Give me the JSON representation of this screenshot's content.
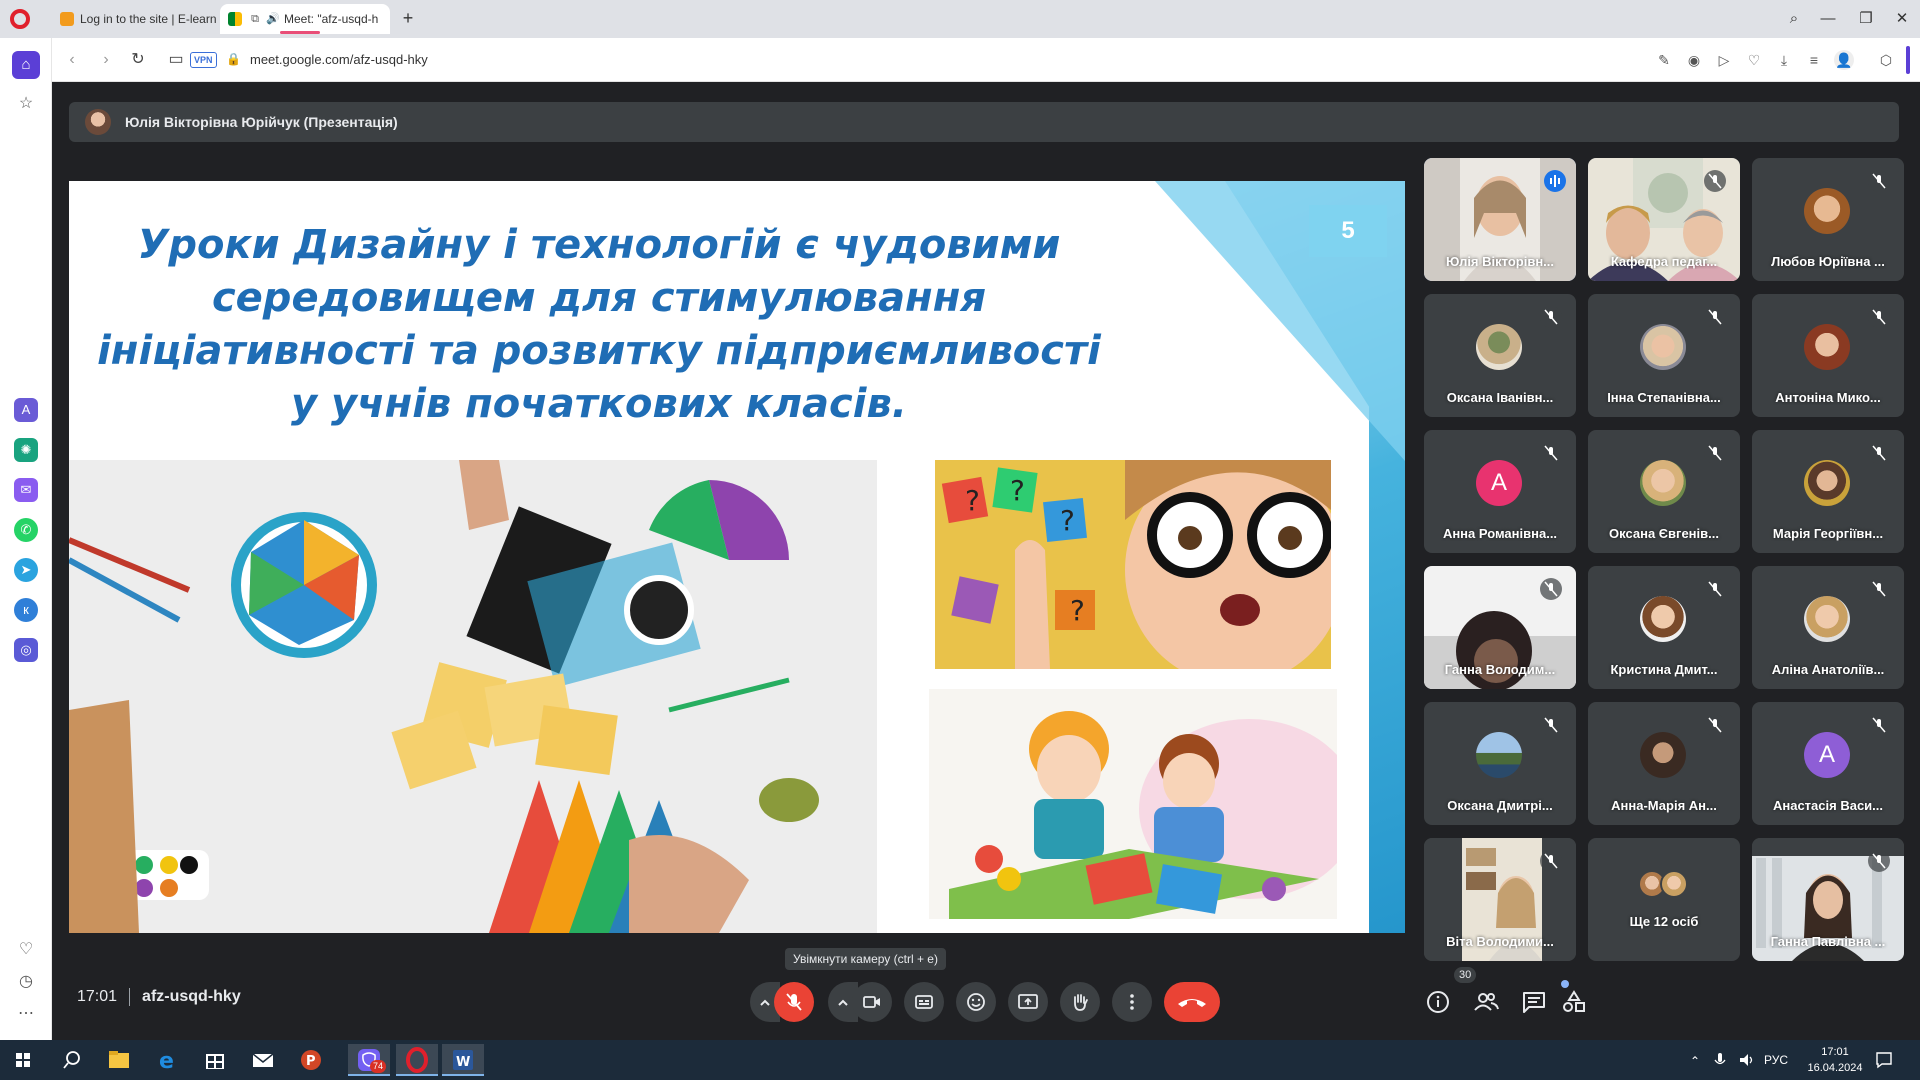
{
  "browser": {
    "tabs": [
      {
        "title": "Log in to the site | E-learn"
      },
      {
        "title": "Meet: \"afz-usqd-h"
      }
    ],
    "vpn_label": "VPN",
    "url": "meet.google.com/afz-usqd-hky"
  },
  "meet": {
    "presenter_label": "Юлія Вікторівна Юрійчук (Презентація)",
    "slide": {
      "number": "5",
      "title_lines": [
        "Уроки Дизайну і технологій є чудовими",
        "середовищем для стимулювання",
        "ініціативності та розвитку підприємливості",
        "у учнів початкових класів."
      ]
    },
    "participants": [
      {
        "name": "Юлія Вікторівн...",
        "speaking": true
      },
      {
        "name": "Кафедра педаг..."
      },
      {
        "name": "Любов Юріївна ..."
      },
      {
        "name": "Оксана Іванівн..."
      },
      {
        "name": "Інна Степанівна..."
      },
      {
        "name": "Антоніна Мико..."
      },
      {
        "name": "Анна Романівна...",
        "initial": "A"
      },
      {
        "name": "Оксана Євгенів..."
      },
      {
        "name": "Марія Георгіївн..."
      },
      {
        "name": "Ганна Володим..."
      },
      {
        "name": "Кристина Дмит..."
      },
      {
        "name": "Аліна Анатоліїв..."
      },
      {
        "name": "Оксана Дмитрі..."
      },
      {
        "name": "Анна-Марія Ан..."
      },
      {
        "name": "Анастасія Васи...",
        "initial": "A"
      },
      {
        "name": "Віта Володими..."
      },
      {
        "name": "Ще 12 осіб"
      },
      {
        "name": "Ганна Павлівна ..."
      }
    ],
    "tooltip": "Увімкнути камеру (ctrl + e)",
    "time": "17:01",
    "meeting_code": "afz-usqd-hky",
    "people_count": "30"
  },
  "taskbar": {
    "viber_badge": "74",
    "lang": "РУС",
    "clock_time": "17:01",
    "clock_date": "16.04.2024"
  },
  "colors": {
    "meet_bg": "#202124",
    "tile_bg": "#3c4043",
    "hangup": "#ea4335",
    "opera_accent": "#5b3fd6",
    "slide_title": "#1f6db5"
  }
}
